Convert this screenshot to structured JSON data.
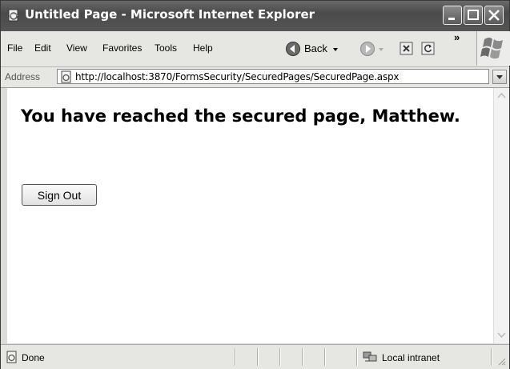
{
  "window": {
    "title": "Untitled Page - Microsoft Internet Explorer"
  },
  "menu": {
    "items": [
      "File",
      "Edit",
      "View",
      "Favorites",
      "Tools",
      "Help"
    ]
  },
  "toolbar": {
    "back_label": "Back",
    "chevron": "»"
  },
  "address": {
    "label": "Address",
    "url": "http://localhost:3870/FormsSecurity/SecuredPages/SecuredPage.aspx"
  },
  "page": {
    "heading": "You have reached the secured page, Matthew.",
    "sign_out_label": "Sign Out"
  },
  "status": {
    "text": "Done",
    "zone": "Local intranet"
  },
  "icons": {
    "app": "ie-page-icon",
    "back": "back-arrow-icon",
    "forward": "forward-arrow-icon",
    "stop": "stop-icon",
    "refresh": "refresh-icon",
    "throbber": "windows-logo-icon",
    "status_page": "page-icon",
    "zone": "intranet-icon"
  }
}
